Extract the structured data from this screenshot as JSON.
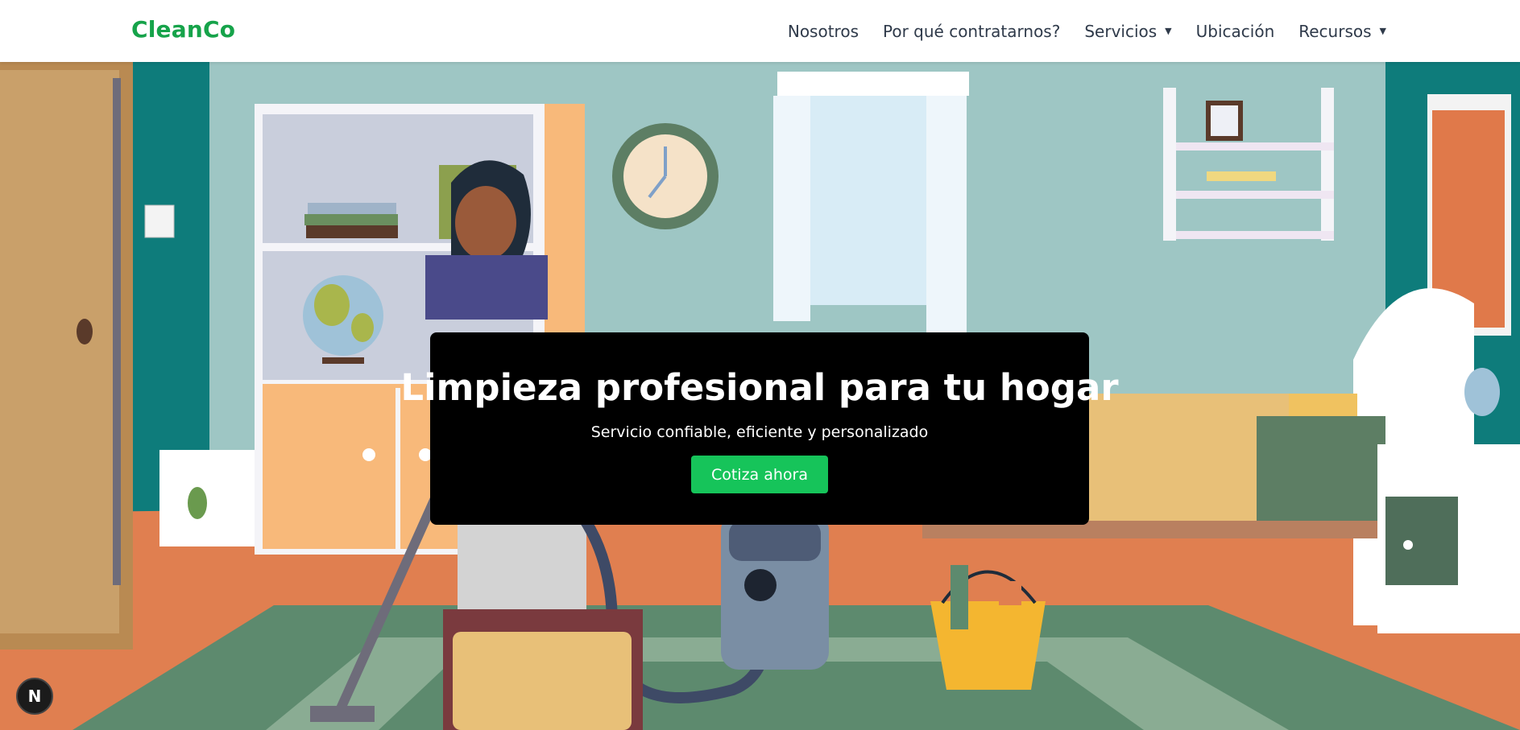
{
  "header": {
    "logo": "CleanCo",
    "nav": [
      {
        "label": "Nosotros",
        "dropdown": false
      },
      {
        "label": "Por qué contratarnos?",
        "dropdown": true
      },
      {
        "label": "Servicios",
        "dropdown": true
      },
      {
        "label": "Ubicación",
        "dropdown": false
      },
      {
        "label": "Recursos",
        "dropdown": true
      }
    ],
    "caret_glyph": "▼"
  },
  "hero": {
    "title": "Limpieza profesional para tu hogar",
    "subtitle": "Servicio confiable, eficiente y personalizado",
    "cta_label": "Cotiza ahora",
    "background_image": "cartoon-room-cleaning-illustration"
  },
  "dev_badge": {
    "icon": "nextjs-icon",
    "glyph": "N"
  },
  "colors": {
    "brand": "#16a34a",
    "cta": "#16c45a",
    "nav_text": "#2f3a4a",
    "card_bg": "#000000"
  }
}
